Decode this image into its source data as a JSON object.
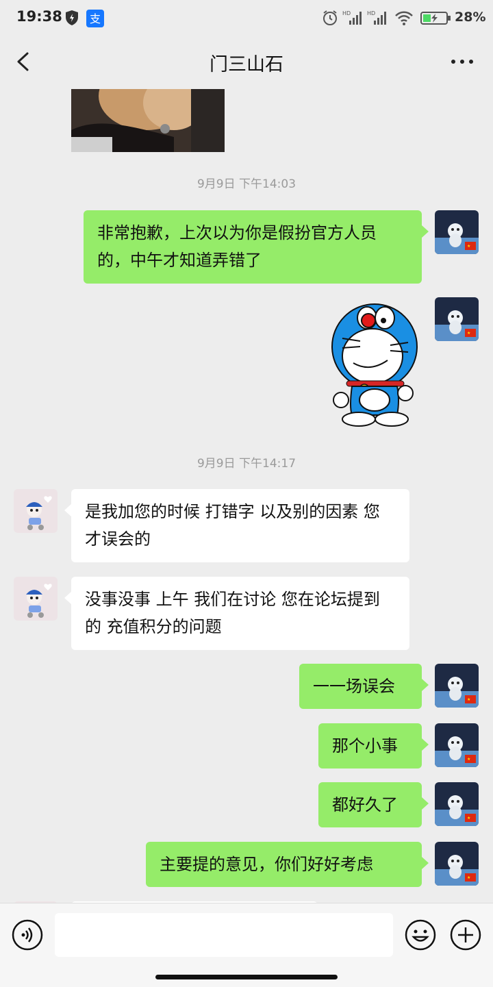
{
  "status_bar": {
    "time": "19:38",
    "battery": "28%",
    "icons": [
      "shield-icon",
      "alipay-icon",
      "alarm-icon",
      "hd-signal-icon",
      "hd-signal-icon",
      "wifi-icon",
      "battery-charging-icon"
    ]
  },
  "header": {
    "title": "门三山石",
    "back_icon": "chevron-left-icon",
    "more_icon": "more-dots-icon"
  },
  "timestamps": [
    "9月9日 下午14:03",
    "9月9日 下午14:17"
  ],
  "messages": [
    {
      "from": "me",
      "text": "非常抱歉，上次以为你是假扮官方人员的，中午才知道弄错了"
    },
    {
      "from": "me",
      "type": "sticker",
      "sticker": "doraemon-thinking"
    },
    {
      "from": "other",
      "text": "是我加您的时候 打错字 以及别的因素 您才误会的"
    },
    {
      "from": "other",
      "text": "没事没事 上午 我们在讨论 您在论坛提到的 充值积分的问题"
    },
    {
      "from": "me",
      "text": "一一场误会"
    },
    {
      "from": "me",
      "text": "那个小事"
    },
    {
      "from": "me",
      "text": "都好久了"
    },
    {
      "from": "me",
      "text": "主要提的意见，你们好好考虑"
    }
  ],
  "input_bar": {
    "voice_icon": "voice-icon",
    "emoji_icon": "emoji-icon",
    "plus_icon": "plus-icon",
    "text_value": ""
  },
  "colors": {
    "bubble_me": "#95ec69",
    "bubble_other": "#ffffff",
    "background": "#ededed"
  }
}
